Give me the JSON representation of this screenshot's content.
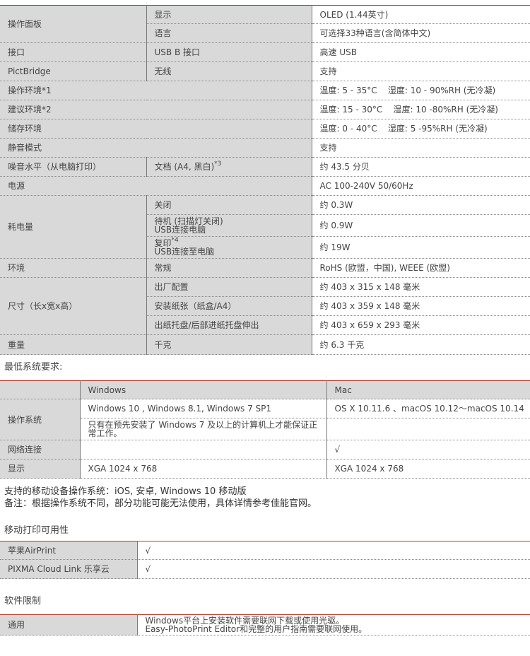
{
  "spec": {
    "panel_label": "操作面板",
    "display_label": "显示",
    "display_value": "OLED (1.44英寸)",
    "language_label": "语言",
    "language_value": "可选择33种语言(含简体中文)",
    "interface_label": "接口",
    "interface_mid": "USB B 接口",
    "interface_value": "高速 USB",
    "pictbridge_label": "PictBridge",
    "pictbridge_mid": "无线",
    "pictbridge_value": "支持",
    "op_env_label": "操作环境*1",
    "op_env_value": "温度: 5 - 35°C    湿度: 10 - 90%RH (无冷凝)",
    "rec_env_label": "建议环境*2",
    "rec_env_value": "温度: 15 - 30°C    湿度: 10 -80%RH (无冷凝)",
    "store_env_label": "储存环境",
    "store_env_value": "温度: 0 - 40°C    湿度: 5 -95%RH (无冷凝)",
    "silent_label": "静音模式",
    "silent_value": "支持",
    "noise_label": "噪音水平（从电脑打印）",
    "noise_mid": "文档 (A4, 黑白)",
    "noise_sup": "*3",
    "noise_value": "约 43.5 分贝",
    "power_label": "电源",
    "power_value": "AC 100-240V 50/60Hz",
    "consumption_label": "耗电量",
    "off_label": "关闭",
    "off_value": "约 0.3W",
    "standby_line1": "待机 (扫描灯关闭)",
    "standby_line2": "USB连接电脑",
    "standby_value": "约 0.9W",
    "copy_line1": "复印",
    "copy_sup": "*4",
    "copy_line2": "USB连接至电脑",
    "copy_value": "约 19W",
    "env_label": "环境",
    "env_mid": "常规",
    "env_value": "RoHS (欧盟，中国), WEEE (欧盟)",
    "size_label": "尺寸（长x宽x高）",
    "size1_mid": "出厂配置",
    "size1_value": "约 403 x 315 x 148 毫米",
    "size2_mid": "安装纸张（纸盒/A4）",
    "size2_value": "约 403 x 359 x 148 毫米",
    "size3_mid": "出纸托盘/后部进纸托盘伸出",
    "size3_value": "约 403 x 659 x 293 毫米",
    "weight_label": "重量",
    "weight_mid": "千克",
    "weight_value": "约 6.3 千克"
  },
  "sysreq": {
    "heading": "最低系统要求:",
    "col_windows": "Windows",
    "col_mac": "Mac",
    "os_label": "操作系统",
    "os_windows": "Windows 10 , Windows 8.1, Windows 7 SP1",
    "os_mac": "OS X 10.11.6 、macOS 10.12～macOS 10.14",
    "os_note": "只有在预先安装了 Windows 7 及以上的计算机上才能保证正常工作。",
    "net_label": "网络连接",
    "net_mac": "√",
    "display_label": "显示",
    "display_windows": "XGA 1024 x 768",
    "display_mac": "XGA 1024 x 768"
  },
  "notes": {
    "mobile_os": "支持的移动设备操作系统：iOS, 安卓, Windows 10 移动版",
    "remark": "备注：根据操作系统不同，部分功能可能无法使用，具体详情参考佳能官网。"
  },
  "mobile": {
    "heading": "移动打印可用性",
    "airprint_label": "苹果AirPrint",
    "airprint_value": "√",
    "cloud_label": "PIXMA Cloud Link 乐享云",
    "cloud_value": "√"
  },
  "software": {
    "heading": "软件限制",
    "general_label": "通用",
    "general_line1": "Windows平台上安装软件需要联网下载或使用光驱。",
    "general_line2": "Easy-PhotoPrint Editor和完整的用户指南需要联网使用。"
  }
}
